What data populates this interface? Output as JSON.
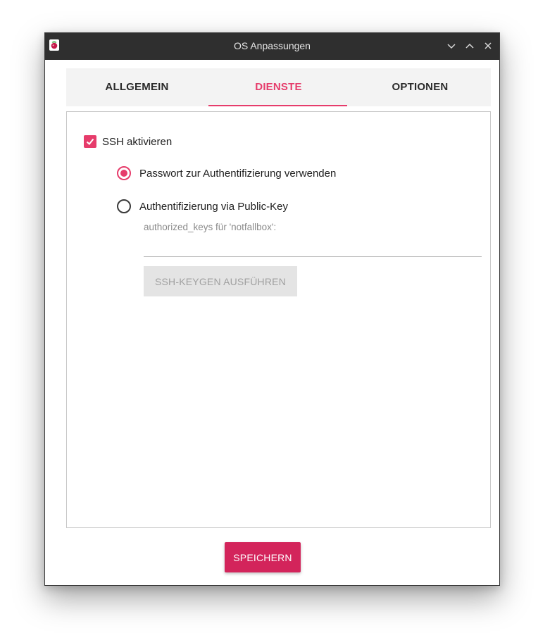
{
  "window": {
    "title": "OS Anpassungen",
    "icon": "raspberry-icon"
  },
  "window_controls": {
    "minimize_icon": "chevron-down-icon",
    "maximize_icon": "chevron-up-icon",
    "close_icon": "close-icon"
  },
  "tabs": [
    {
      "label": "ALLGEMEIN",
      "active": false
    },
    {
      "label": "DIENSTE",
      "active": true
    },
    {
      "label": "OPTIONEN",
      "active": false
    }
  ],
  "ssh": {
    "enable_label": "SSH aktivieren",
    "enabled": true,
    "auth_options": [
      {
        "label": "Passwort zur Authentifizierung verwenden",
        "checked": true
      },
      {
        "label": "Authentifizierung via Public-Key",
        "checked": false
      }
    ],
    "authorized_keys_label": "authorized_keys für 'notfallbox':",
    "authorized_keys_value": "",
    "keygen_button": "SSH-KEYGEN AUSFÜHREN",
    "keygen_enabled": false
  },
  "footer": {
    "save_button": "SPEICHERN"
  },
  "colors": {
    "accent": "#e63c6b",
    "save_button": "#d3245b",
    "titlebar": "#2f2f2f"
  }
}
